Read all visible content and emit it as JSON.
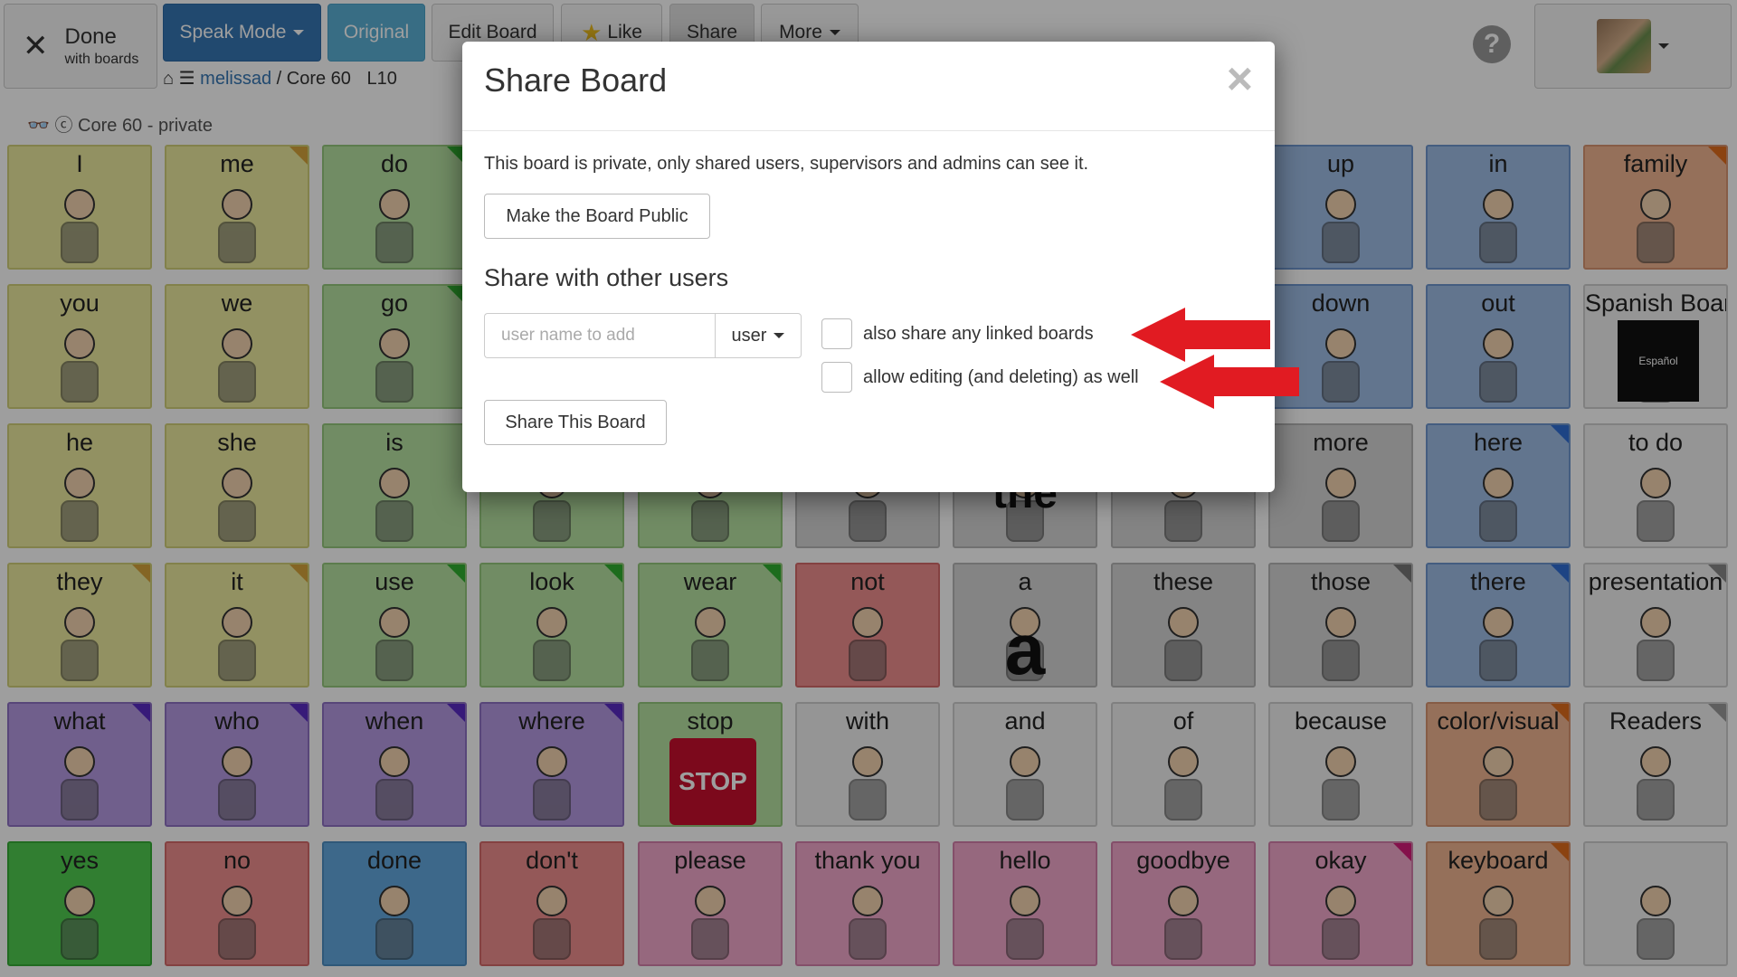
{
  "header": {
    "done_label": "Done",
    "done_sub": "with boards",
    "speak_mode": "Speak Mode",
    "original": "Original",
    "edit_board": "Edit Board",
    "like": "Like",
    "share": "Share",
    "more": "More",
    "crumb_user": "melissad",
    "crumb_sep": "/",
    "crumb_board": "Core 60",
    "crumb_level": "L10",
    "help": "?"
  },
  "subtitle": "Core 60 - private",
  "tiles": [
    {
      "label": "I",
      "color": "c-yel"
    },
    {
      "label": "me",
      "color": "c-yel"
    },
    {
      "label": "do",
      "color": "c-grn"
    },
    {
      "label": "",
      "color": "c-grn"
    },
    {
      "label": "",
      "color": "c-grn"
    },
    {
      "label": "",
      "color": "c-red"
    },
    {
      "label": "",
      "color": "c-gry"
    },
    {
      "label": "",
      "color": "c-gry"
    },
    {
      "label": "up",
      "color": "c-blu"
    },
    {
      "label": "in",
      "color": "c-blu"
    },
    {
      "label": "family",
      "color": "c-ora"
    },
    {
      "label": "you",
      "color": "c-yel"
    },
    {
      "label": "we",
      "color": "c-yel"
    },
    {
      "label": "go",
      "color": "c-grn"
    },
    {
      "label": "",
      "color": "c-grn"
    },
    {
      "label": "",
      "color": "c-grn"
    },
    {
      "label": "",
      "color": "c-red"
    },
    {
      "label": "",
      "color": "c-gry"
    },
    {
      "label": "",
      "color": "c-gry"
    },
    {
      "label": "down",
      "color": "c-blu"
    },
    {
      "label": "out",
      "color": "c-blu"
    },
    {
      "label": "Spanish Board",
      "color": "c-wht"
    },
    {
      "label": "he",
      "color": "c-yel"
    },
    {
      "label": "she",
      "color": "c-yel"
    },
    {
      "label": "is",
      "color": "c-grn"
    },
    {
      "label": "",
      "color": "c-grn"
    },
    {
      "label": "",
      "color": "c-grn"
    },
    {
      "label": "",
      "color": "c-gry"
    },
    {
      "label": "",
      "color": "c-gry"
    },
    {
      "label": "",
      "color": "c-gry"
    },
    {
      "label": "more",
      "color": "c-gry"
    },
    {
      "label": "here",
      "color": "c-blu"
    },
    {
      "label": "to do",
      "color": "c-wht"
    },
    {
      "label": "they",
      "color": "c-yel"
    },
    {
      "label": "it",
      "color": "c-yel"
    },
    {
      "label": "use",
      "color": "c-grn"
    },
    {
      "label": "look",
      "color": "c-grn"
    },
    {
      "label": "wear",
      "color": "c-grn"
    },
    {
      "label": "not",
      "color": "c-red"
    },
    {
      "label": "a",
      "color": "c-gry"
    },
    {
      "label": "these",
      "color": "c-gry"
    },
    {
      "label": "those",
      "color": "c-gry"
    },
    {
      "label": "there",
      "color": "c-blu"
    },
    {
      "label": "presentation",
      "color": "c-wht"
    },
    {
      "label": "what",
      "color": "c-pur"
    },
    {
      "label": "who",
      "color": "c-pur"
    },
    {
      "label": "when",
      "color": "c-pur"
    },
    {
      "label": "where",
      "color": "c-pur"
    },
    {
      "label": "stop",
      "color": "c-grn"
    },
    {
      "label": "with",
      "color": "c-wht"
    },
    {
      "label": "and",
      "color": "c-wht"
    },
    {
      "label": "of",
      "color": "c-wht"
    },
    {
      "label": "because",
      "color": "c-wht"
    },
    {
      "label": "color/visual",
      "color": "c-ora"
    },
    {
      "label": "Readers",
      "color": "c-wht"
    },
    {
      "label": "yes",
      "color": "c-bgn"
    },
    {
      "label": "no",
      "color": "c-red"
    },
    {
      "label": "done",
      "color": "c-dbl"
    },
    {
      "label": "don't",
      "color": "c-red"
    },
    {
      "label": "please",
      "color": "c-pnk"
    },
    {
      "label": "thank you",
      "color": "c-pnk"
    },
    {
      "label": "hello",
      "color": "c-pnk"
    },
    {
      "label": "goodbye",
      "color": "c-pnk"
    },
    {
      "label": "okay",
      "color": "c-pnk"
    },
    {
      "label": "keyboard",
      "color": "c-ora"
    },
    {
      "label": "",
      "color": "c-wht"
    }
  ],
  "partial_labels": {
    "the": "the",
    "stop_sign": "STOP",
    "a_glyph": "a",
    "espanol": "Español"
  },
  "modal": {
    "title": "Share Board",
    "close": "×",
    "privacy_text": "This board is private, only shared users, supervisors and admins can see it.",
    "make_public": "Make the Board Public",
    "share_heading": "Share with other users",
    "user_placeholder": "user name to add",
    "type_select": "user",
    "linked_label": "also share any linked boards",
    "editing_label": "allow editing (and deleting) as well",
    "share_button": "Share This Board"
  },
  "colors": {
    "arrow": "#e11b22",
    "primary": "#3677b4",
    "info": "#5bb1d6"
  }
}
